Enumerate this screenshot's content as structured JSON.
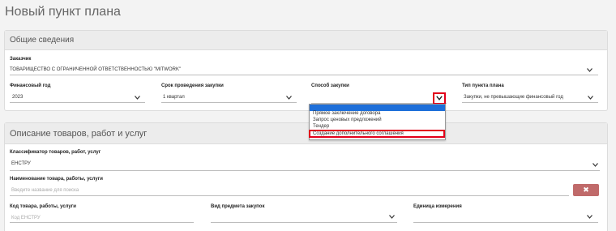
{
  "page_title": "Новый пункт плана",
  "general": {
    "header": "Общие сведения",
    "customer": {
      "label": "Заказчик",
      "value": "ТОВАРИЩЕСТВО С ОГРАНИЧЕННОЙ ОТВЕТСТВЕННОСТЬЮ \"MITWORK\""
    },
    "fin_year": {
      "label": "Финансовый год",
      "value": "2023"
    },
    "period": {
      "label": "Срок проведения закупки",
      "value": "1 квартал"
    },
    "method": {
      "label": "Способ закупки",
      "value": ""
    },
    "item_type": {
      "label": "Тип пункта плана",
      "value": "Закупки, не превышающие финансовый год"
    }
  },
  "method_dropdown": {
    "options": [
      "Прямое заключение договора",
      "Запрос ценовых предложений",
      "Тендер",
      "Создание дополнительного соглашения"
    ]
  },
  "goods": {
    "header": "Описание товаров, работ и услуг",
    "classifier": {
      "label": "Классификатор товаров, работ, услуг",
      "value": "ЕНСТРУ"
    },
    "name": {
      "label": "Наименование товара, работы, услуги",
      "placeholder": "Введите название для поиска",
      "clear_label": "✖"
    },
    "code": {
      "label": "Код товара, работы, услуги",
      "placeholder": "Код ЕНСТРУ"
    },
    "subject": {
      "label": "Вид предмета закупок",
      "value": ""
    },
    "unit": {
      "label": "Единица измерения",
      "value": ""
    }
  }
}
